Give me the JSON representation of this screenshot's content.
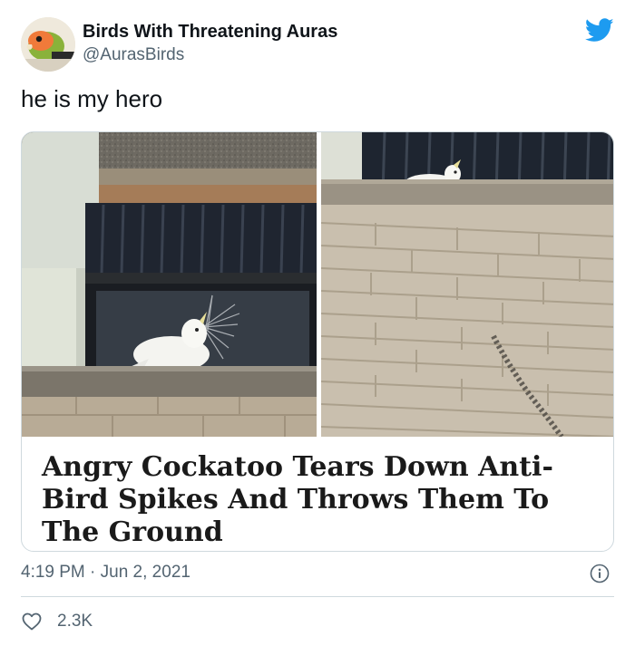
{
  "tweet": {
    "display_name": "Birds With Threatening Auras",
    "handle": "@AurasBirds",
    "text": "he is my hero",
    "timestamp": "4:19 PM · Jun 2, 2021",
    "like_count": "2.3K"
  },
  "card": {
    "headline": "Angry Cockatoo Tears Down Anti-Bird Spikes And Throws Them To The Ground"
  },
  "icons": {
    "logo": "twitter-bird-icon",
    "info": "info-icon",
    "like": "heart-icon"
  },
  "colors": {
    "brand": "#1d9bf0",
    "text": "#0f1419",
    "secondary": "#536471",
    "border": "#cfd9de"
  }
}
